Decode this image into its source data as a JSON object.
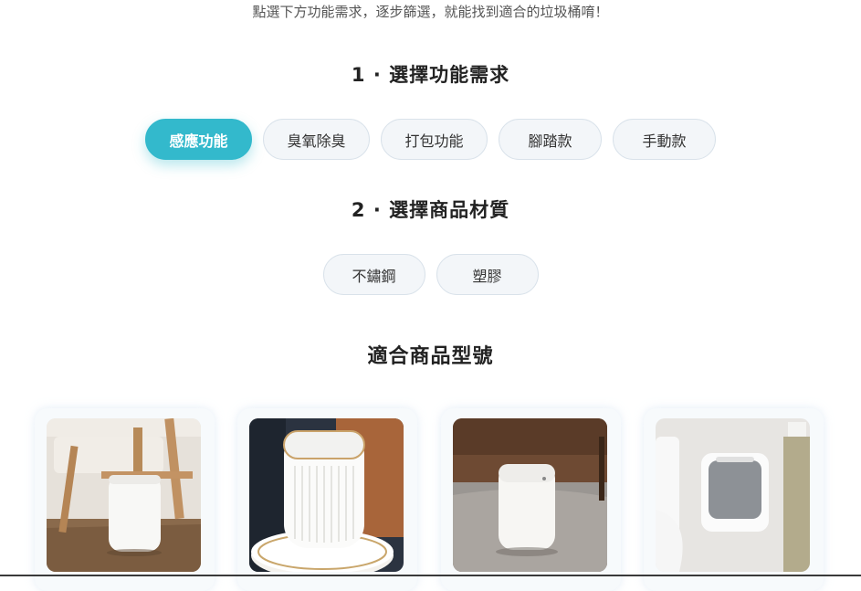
{
  "intro": {
    "text": "點選下方功能需求，逐步篩選，就能找到適合的垃圾桶唷！"
  },
  "step1": {
    "title": "1 · 選擇功能需求",
    "options": [
      "感應功能",
      "臭氧除臭",
      "打包功能",
      "腳踏款",
      "手動款"
    ],
    "selected": "感應功能"
  },
  "step2": {
    "title": "2 · 選擇商品材質",
    "options": [
      "不鏽鋼",
      "塑膠"
    ]
  },
  "results": {
    "title": "適合商品型號",
    "products": [
      {
        "image": "white-sensor-trash-can-by-wooden-chair"
      },
      {
        "image": "white-fluted-oval-trash-can-gold-trim"
      },
      {
        "image": "white-sensor-trash-can-on-rug"
      },
      {
        "image": "wall-mounted-trash-can-in-bathroom"
      }
    ]
  },
  "colors": {
    "accent": "#33b9cc",
    "pill_bg": "#f3f6f9",
    "pill_border": "#d9e2ea"
  }
}
